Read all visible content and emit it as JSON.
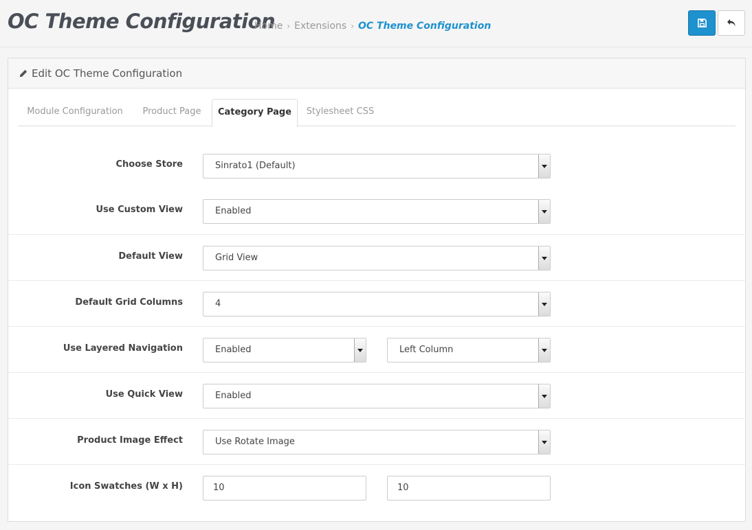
{
  "header": {
    "title": "OC Theme Configuration",
    "breadcrumb": [
      "Home",
      "Extensions",
      "OC Theme Configuration"
    ],
    "save_icon": "floppy-disk-icon",
    "back_icon": "reply-arrow-icon"
  },
  "panel": {
    "heading": "Edit OC Theme Configuration",
    "heading_icon": "pencil-icon"
  },
  "tabs": [
    {
      "label": "Module Configuration",
      "active": false
    },
    {
      "label": "Product Page",
      "active": false
    },
    {
      "label": "Category Page",
      "active": true
    },
    {
      "label": "Stylesheet CSS",
      "active": false
    }
  ],
  "form": {
    "choose_store": {
      "label": "Choose Store",
      "value": "Sinrato1 (Default)"
    },
    "use_custom_view": {
      "label": "Use Custom View",
      "value": "Enabled"
    },
    "default_view": {
      "label": "Default View",
      "value": "Grid View"
    },
    "default_grid_columns": {
      "label": "Default Grid Columns",
      "value": "4"
    },
    "use_layered_navigation": {
      "label": "Use Layered Navigation",
      "value": "Enabled",
      "position": "Left Column"
    },
    "use_quick_view": {
      "label": "Use Quick View",
      "value": "Enabled"
    },
    "product_image_effect": {
      "label": "Product Image Effect",
      "value": "Use Rotate Image"
    },
    "icon_swatches": {
      "label": "Icon Swatches (W x H)",
      "width": "10",
      "height": "10"
    }
  },
  "colors": {
    "accent": "#1e91cf",
    "title": "#4a4e57"
  }
}
